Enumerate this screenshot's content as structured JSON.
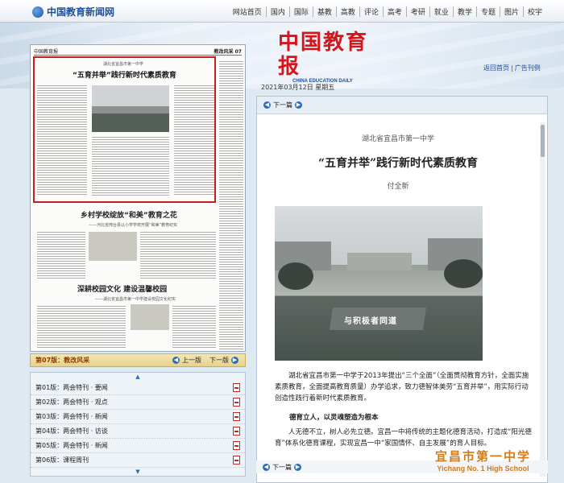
{
  "site": {
    "logo_text": "中国教育新闻网",
    "nav": [
      "网站首页",
      "国内",
      "国际",
      "基教",
      "高教",
      "评论",
      "高考",
      "考研",
      "就业",
      "教学",
      "专题",
      "图片",
      "校宇"
    ]
  },
  "masthead": {
    "title": "中国教育报",
    "subtitle": "CHINA EDUCATION DAILY",
    "links": [
      "返回首页",
      "广告刊例"
    ]
  },
  "date": "2021年03月12日  星期五",
  "page_thumbnail": {
    "paper_name": "中国教育报",
    "edition_label": "教改风采 07",
    "headline1_sub": "湖北省宜昌市第一中学",
    "headline1": "“五育并举”践行新时代素质教育",
    "headline2": "乡村学校绽放“和美”教育之花",
    "headline2_sub": "——河北省邢台县以小学学校开展“和美”教育纪实",
    "headline3": "深耕校园文化  建设温馨校园",
    "headline3_sub": "——湖北省宜昌市第一中学建设校园文化纪实"
  },
  "edition_bar": {
    "current": "第07版：教改风采",
    "prev": "上一版",
    "next": "下一版"
  },
  "edition_list": [
    "第01版：两会特刊 · 要闻",
    "第02版：两会特刊 · 观点",
    "第03版：两会特刊 · 新闻",
    "第04版：两会特刊 · 访谈",
    "第05版：两会特刊 · 新闻",
    "第06版：课程周刊"
  ],
  "article": {
    "nav_prev": "下一篇",
    "source": "湖北省宜昌市第一中学",
    "title": "“五育并举”践行新时代素质教育",
    "author": "付全新",
    "photo_sign": "与积极者同道",
    "para1": "湖北省宜昌市第一中学于2013年提出“三个全面”（全面贯彻教育方针，全面实施素质教育，全面提高教育质量）办学追求，致力德智体美劳“五育并举”，用实际行动创造性践行着新时代素质教育。",
    "subhead1": "德育立人，以灵魂塑造为根本",
    "para2": "人无德不立，树人必先立德。宜昌一中将传统的主题化德育活动，打造成“阳光德育”体系化德育课程，实现宜昌一中“家国情怀、自主发展”的育人目标。",
    "foot_nav": "下一篇"
  },
  "watermark": {
    "cn": "宜昌市第一中学",
    "en": "Yichang No. 1 High School"
  }
}
